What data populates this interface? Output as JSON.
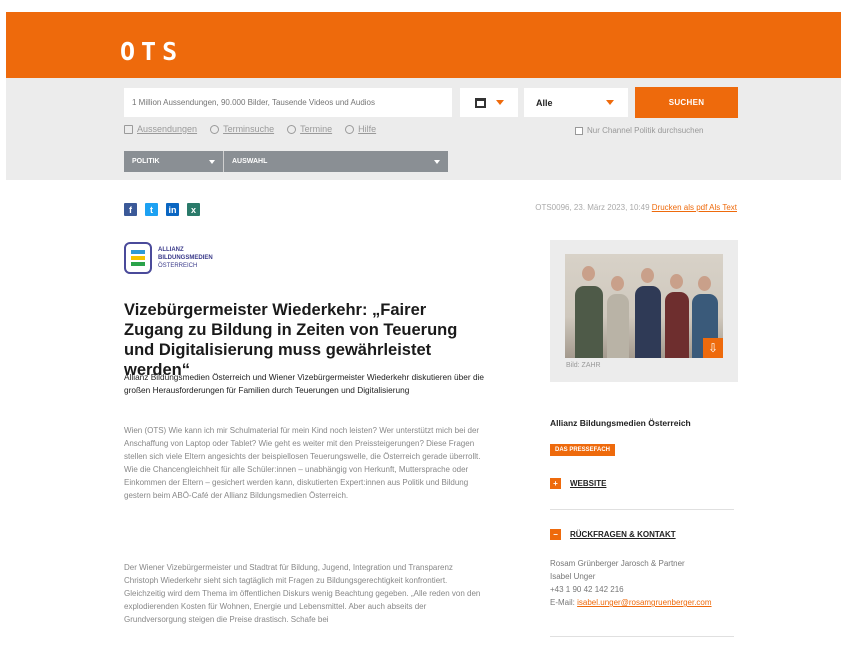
{
  "header": {
    "logo": "OTS"
  },
  "search": {
    "placeholder": "1 Million Aussendungen, 90.000 Bilder, Tausende Videos und Audios",
    "type_value": "Alle",
    "button_label": "SUCHEN",
    "channel_option": "Nur Channel Politik durchsuchen"
  },
  "quicklinks": [
    "Aussendungen",
    "Terminsuche",
    "Termine",
    "Hilfe"
  ],
  "filters": {
    "ressort": "POLITIK",
    "channel": "AUSWAHL"
  },
  "share": [
    "f",
    "t",
    "in",
    "x"
  ],
  "meta": {
    "text": "OTS0096, 23. März 2023, 10:49",
    "links": "Drucken als pdf Als Text"
  },
  "org_logo": {
    "line1": "ALLIANZ",
    "line2": "BILDUNGSMEDIEN",
    "line3": "ÖSTERREICH"
  },
  "article": {
    "headline": "Vizebürgermeister Wiederkehr: „Fairer Zugang zu Bildung in Zeiten von Teuerung und Digitalisierung muss gewährleistet werden“",
    "lead": "Allianz Bildungsmedien Österreich und Wiener Vizebürgermeister Wiederkehr diskutieren über die großen Herausforderungen für Familien durch Teuerungen und Digitalisierung",
    "p1": "Wien (OTS) Wie kann ich mir Schulmaterial für mein Kind noch leisten? Wer unterstützt mich bei der Anschaffung von Laptop oder Tablet? Wie geht es weiter mit den Preissteigerungen? Diese Fragen stellen sich viele Eltern angesichts der beispiellosen Teuerungswelle, die Österreich gerade überrollt. Wie die Chancengleichheit für alle Schüler:innen – unabhängig von Herkunft, Muttersprache oder Einkommen der Eltern – gesichert werden kann, diskutierten Expert:innen aus Politik und Bildung gestern beim ABÖ-Café der Allianz Bildungsmedien Österreich.",
    "p2": "Der Wiener Vizebürgermeister und Stadtrat für Bildung, Jugend, Integration und Transparenz Christoph Wiederkehr sieht sich tagtäglich mit Fragen zu Bildungsgerechtigkeit konfrontiert. Gleichzeitig wird dem Thema im öffentlichen Diskurs wenig Beachtung gegeben. „Alle reden von den explodierenden Kosten für Wohnen, Energie und Lebensmittel. Aber auch abseits der Grundversorgung steigen die Preise drastisch. Schafe bei"
  },
  "photo": {
    "caption": "Bild: ZAHR"
  },
  "sidebar": {
    "org": "Allianz Bildungsmedien Österreich",
    "badge": "DAS PRESSEFACH",
    "link1": "WEBSITE",
    "link2": "RÜCKFRAGEN & KONTAKT",
    "contact_line1": "Rosam Grünberger Jarosch & Partner",
    "contact_line2": "Isabel Unger",
    "contact_line3": "+43 1 90 42 142 216",
    "contact_email_label": "E-Mail:",
    "contact_email": "isabel.unger@rosamgruenberger.com"
  },
  "colors": {
    "brand": "#ee6a0c",
    "band": "#ececec",
    "filter": "#8a8f94"
  }
}
